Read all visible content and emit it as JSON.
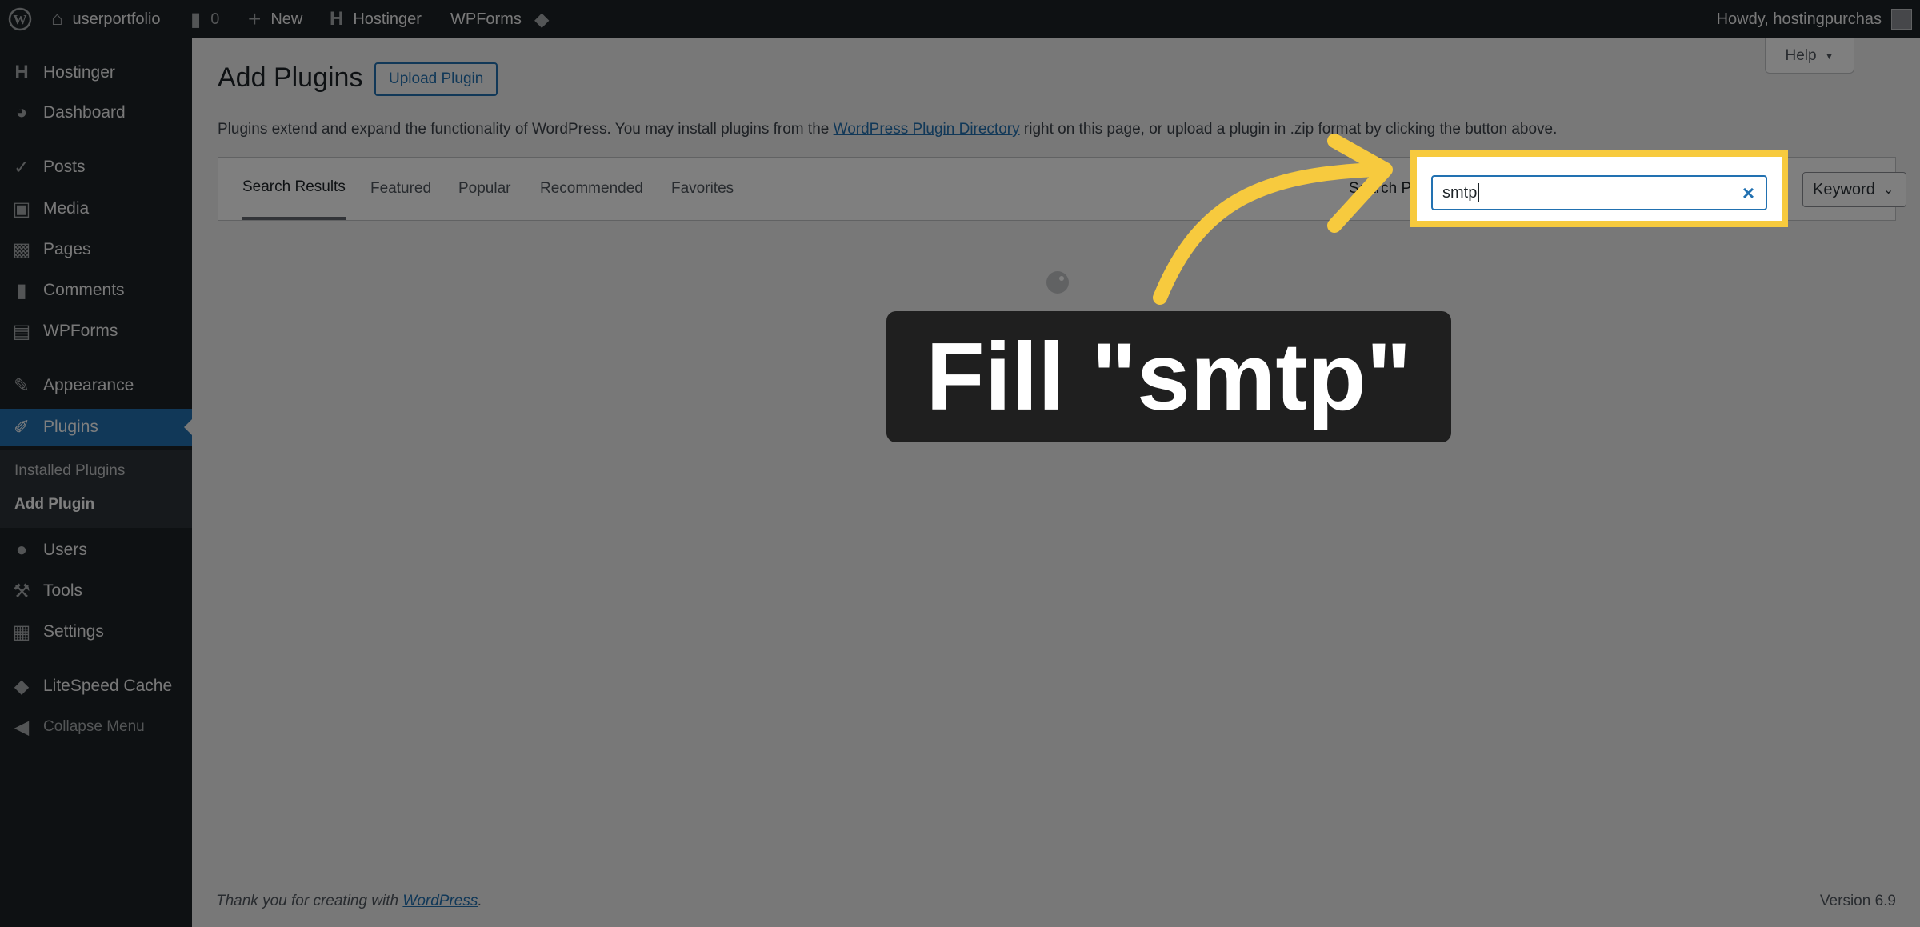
{
  "admin_bar": {
    "site_name": "userportfolio",
    "comments_count": "0",
    "new_label": "New",
    "hostinger_label": "Hostinger",
    "wpforms_label": "WPForms",
    "howdy": "Howdy, hostingpurchas"
  },
  "sidebar": {
    "items": [
      {
        "label": "Hostinger",
        "icon": "hostinger-icon"
      },
      {
        "label": "Dashboard",
        "icon": "dashboard-icon"
      },
      {
        "label": "Posts",
        "icon": "pin-icon"
      },
      {
        "label": "Media",
        "icon": "media-icon"
      },
      {
        "label": "Pages",
        "icon": "pages-icon"
      },
      {
        "label": "Comments",
        "icon": "comment-icon"
      },
      {
        "label": "WPForms",
        "icon": "wpforms-icon"
      },
      {
        "label": "Appearance",
        "icon": "brush-icon"
      },
      {
        "label": "Plugins",
        "icon": "plugin-icon"
      },
      {
        "label": "Users",
        "icon": "user-icon"
      },
      {
        "label": "Tools",
        "icon": "wrench-icon"
      },
      {
        "label": "Settings",
        "icon": "settings-icon"
      },
      {
        "label": "LiteSpeed Cache",
        "icon": "diamond-icon"
      },
      {
        "label": "Collapse Menu",
        "icon": "collapse-icon"
      }
    ],
    "submenu": [
      "Installed Plugins",
      "Add Plugin"
    ]
  },
  "main": {
    "title": "Add Plugins",
    "upload_button": "Upload Plugin",
    "help_label": "Help",
    "intro_before": "Plugins extend and expand the functionality of WordPress. You may install plugins from the ",
    "intro_link": "WordPress Plugin Directory",
    "intro_after": " right on this page, or upload a plugin in .zip format by clicking the button above.",
    "tabs": [
      "Search Results",
      "Featured",
      "Popular",
      "Recommended",
      "Favorites"
    ],
    "search_label": "Search Plugins",
    "search_value": "smtp",
    "search_type": "Keyword"
  },
  "footer": {
    "thanks_before": "Thank you for creating with ",
    "thanks_link": "WordPress",
    "thanks_after": ".",
    "version": "Version 6.9"
  },
  "overlay": {
    "callout_text": "Fill \"smtp\"",
    "highlight_color": "#f7ca3e"
  },
  "colors": {
    "admin_bg": "#1d2327",
    "accent": "#2271b1"
  }
}
